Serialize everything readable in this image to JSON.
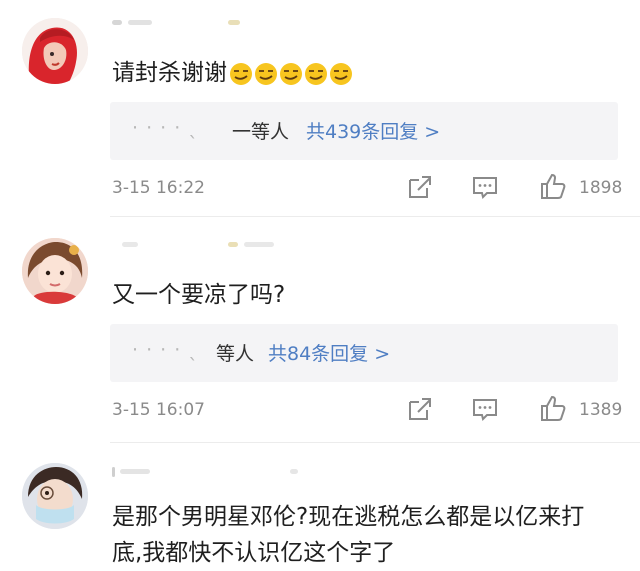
{
  "comments": [
    {
      "text": "请封杀谢谢",
      "emoji_count": 5,
      "reply_names": "· ·  ·  ·  ˎ",
      "reply_suffix": "一等人",
      "reply_count_text": "共439条回复 >",
      "timestamp": "3-15 16:22",
      "likes": "1898"
    },
    {
      "text": "又一个要凉了吗?",
      "reply_names": "· ·  ·  ·  ˎ",
      "reply_suffix": "等人",
      "reply_count_text": "共84条回复 >",
      "timestamp": "3-15 16:07",
      "likes": "1389"
    },
    {
      "text": "是那个男明星邓伦?现在逃税怎么都是以亿来打底,我都快不认识亿这个字了"
    }
  ],
  "icons": {
    "share": "share-icon",
    "comment": "comment-icon",
    "like": "thumbs-up-icon"
  },
  "colors": {
    "link_blue": "#4f7ec3",
    "meta_gray": "#8a8a8a",
    "reply_bg": "#f4f4f6"
  }
}
